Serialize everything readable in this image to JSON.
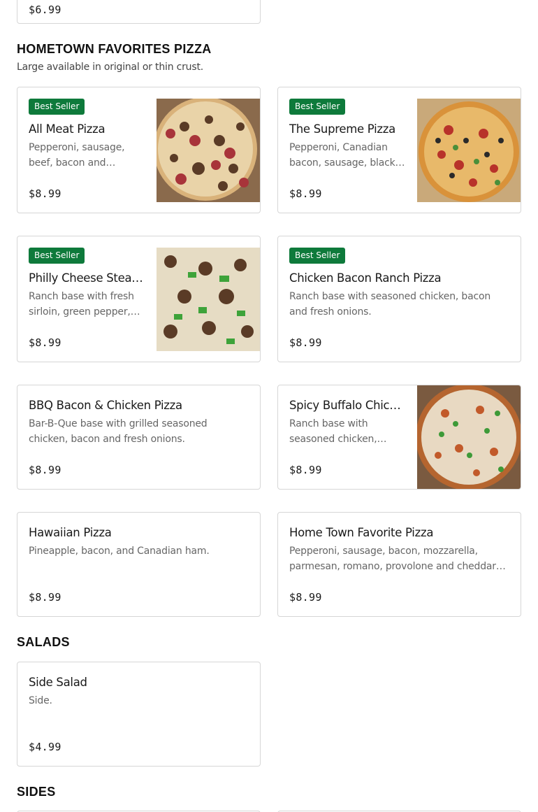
{
  "top_card": {
    "price": "$6.99"
  },
  "sections": {
    "pizza": {
      "title": "HOMETOWN FAVORITES PIZZA",
      "subtitle": "Large available in original or thin crust."
    },
    "salads": {
      "title": "SALADS"
    },
    "sides": {
      "title": "SIDES"
    }
  },
  "items": {
    "all_meat": {
      "badge": "Best Seller",
      "name": "All Meat Pizza",
      "desc": "Pepperoni, sausage, beef, bacon and Canadian…",
      "price": "$8.99"
    },
    "supreme": {
      "badge": "Best Seller",
      "name": "The Supreme Pizza",
      "desc": "Pepperoni, Canadian bacon, sausage, black…",
      "price": "$8.99"
    },
    "philly": {
      "badge": "Best Seller",
      "name": "Philly Cheese Steak…",
      "desc": "Ranch base with fresh sirloin, green pepper,…",
      "price": "$8.99"
    },
    "chicken_bacon_ranch": {
      "badge": "Best Seller",
      "name": "Chicken Bacon Ranch Pizza",
      "desc": "Ranch base with seasoned chicken, bacon and fresh onions.",
      "price": "$8.99"
    },
    "bbq": {
      "name": "BBQ Bacon & Chicken Pizza",
      "desc": "Bar-B-Que base with grilled seasoned chicken, bacon and fresh onions.",
      "price": "$8.99"
    },
    "spicy_buffalo": {
      "name": "Spicy Buffalo Chicke…",
      "desc": "Ranch base with seasoned chicken,…",
      "price": "$8.99"
    },
    "hawaiian": {
      "name": "Hawaiian Pizza",
      "desc": "Pineapple, bacon, and Canadian ham.",
      "price": "$8.99"
    },
    "home_town": {
      "name": "Home Town Favorite Pizza",
      "desc": "Pepperoni, sausage, bacon, mozzarella, parmesan, romano, provolone and cheddar jac…",
      "price": "$8.99"
    },
    "side_salad": {
      "name": "Side Salad",
      "desc": "Side.",
      "price": "$4.99"
    }
  }
}
